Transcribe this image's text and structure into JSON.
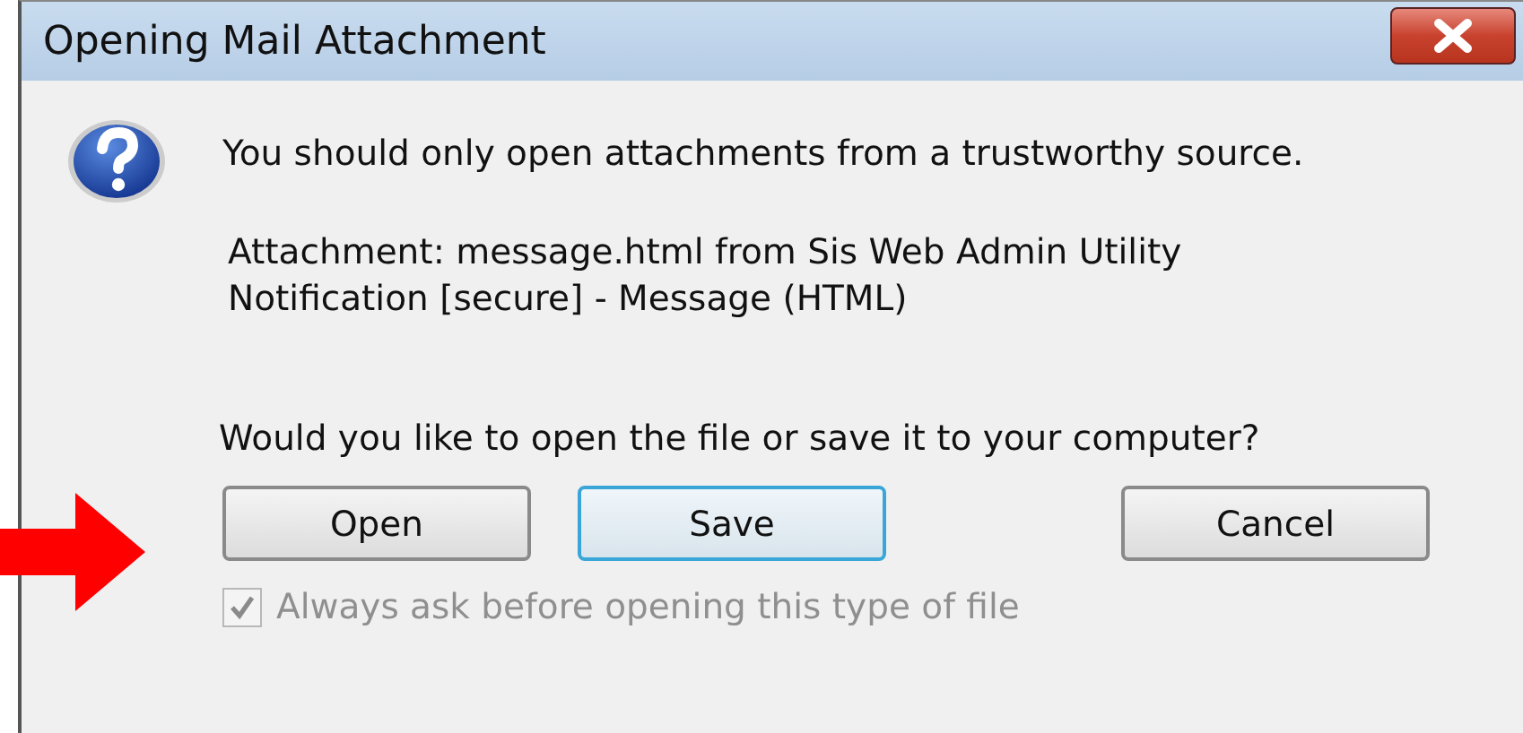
{
  "window": {
    "title": "Opening Mail Attachment"
  },
  "message": "You should only open attachments from a trustworthy source.",
  "attachment_lines": [
    "Attachment: message.html from Sis Web Admin Utility",
    "Notification [secure] - Message (HTML)"
  ],
  "question": "Would you like to open the file or save it to your computer?",
  "buttons": [
    {
      "label": "Open",
      "focused": false
    },
    {
      "label": "Save",
      "focused": true
    },
    {
      "label": "Cancel",
      "focused": false
    }
  ],
  "checkbox": {
    "label": "Always ask before opening this type of file",
    "checked": true,
    "disabled": true
  }
}
